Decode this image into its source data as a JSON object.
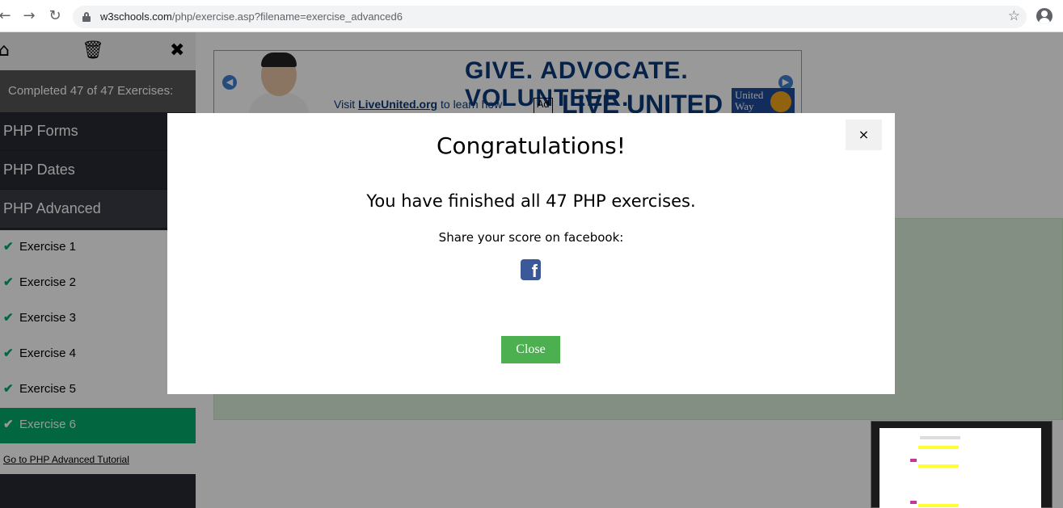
{
  "browser": {
    "back_icon": "arrow-left-icon",
    "forward_icon": "arrow-right-icon",
    "reload_icon": "reload-icon",
    "url_host": "w3schools.com",
    "url_path": "/php/exercise.asp?filename=exercise_advanced6"
  },
  "sidebar": {
    "completed_text": "Completed 47 of 47 Exercises:",
    "categories": [
      {
        "label": "PHP Forms"
      },
      {
        "label": "PHP Dates"
      },
      {
        "label": "PHP Advanced"
      }
    ],
    "exercises": [
      {
        "label": "Exercise 1"
      },
      {
        "label": "Exercise 2"
      },
      {
        "label": "Exercise 3"
      },
      {
        "label": "Exercise 4"
      },
      {
        "label": "Exercise 5"
      },
      {
        "label": "Exercise 6"
      }
    ],
    "tutorial_link": "Go to PHP Advanced Tutorial",
    "accent_color": "#04AA6D"
  },
  "ad": {
    "headline": "GIVE. ADVOCATE. VOLUNTEER.",
    "brand": "LIVE UNITED",
    "visit_prefix": "Visit",
    "visit_link": "LiveUnited.org",
    "visit_suffix": "to learn how",
    "org_line1": "United",
    "org_line2": "Way",
    "ad_council": "Ad"
  },
  "modal": {
    "close_x": "×",
    "title": "Congratulations!",
    "message": "You have finished all 47 PHP exercises.",
    "share_text": "Share your score on facebook:",
    "share_icon": "facebook-icon",
    "close_label": "Close",
    "close_color": "#4CAF50"
  }
}
